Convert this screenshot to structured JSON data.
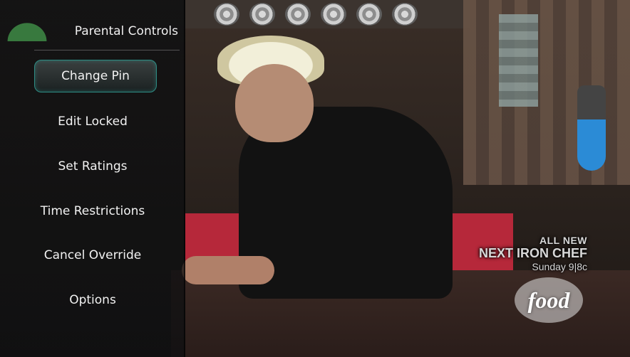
{
  "menu": {
    "title": "Parental Controls",
    "items": [
      {
        "label": "Change Pin",
        "selected": true
      },
      {
        "label": "Edit Locked",
        "selected": false
      },
      {
        "label": "Set Ratings",
        "selected": false
      },
      {
        "label": "Time Restrictions",
        "selected": false
      },
      {
        "label": "Cancel Override",
        "selected": false
      },
      {
        "label": "Options",
        "selected": false
      }
    ]
  },
  "promo": {
    "line1": "ALL NEW",
    "line2": "NEXT IRON CHEF",
    "line3": "Sunday 9|8c"
  },
  "network": {
    "logo_text": "food"
  },
  "colors": {
    "selection_border": "#2e8c84",
    "panel_background": "#0c0e10"
  }
}
